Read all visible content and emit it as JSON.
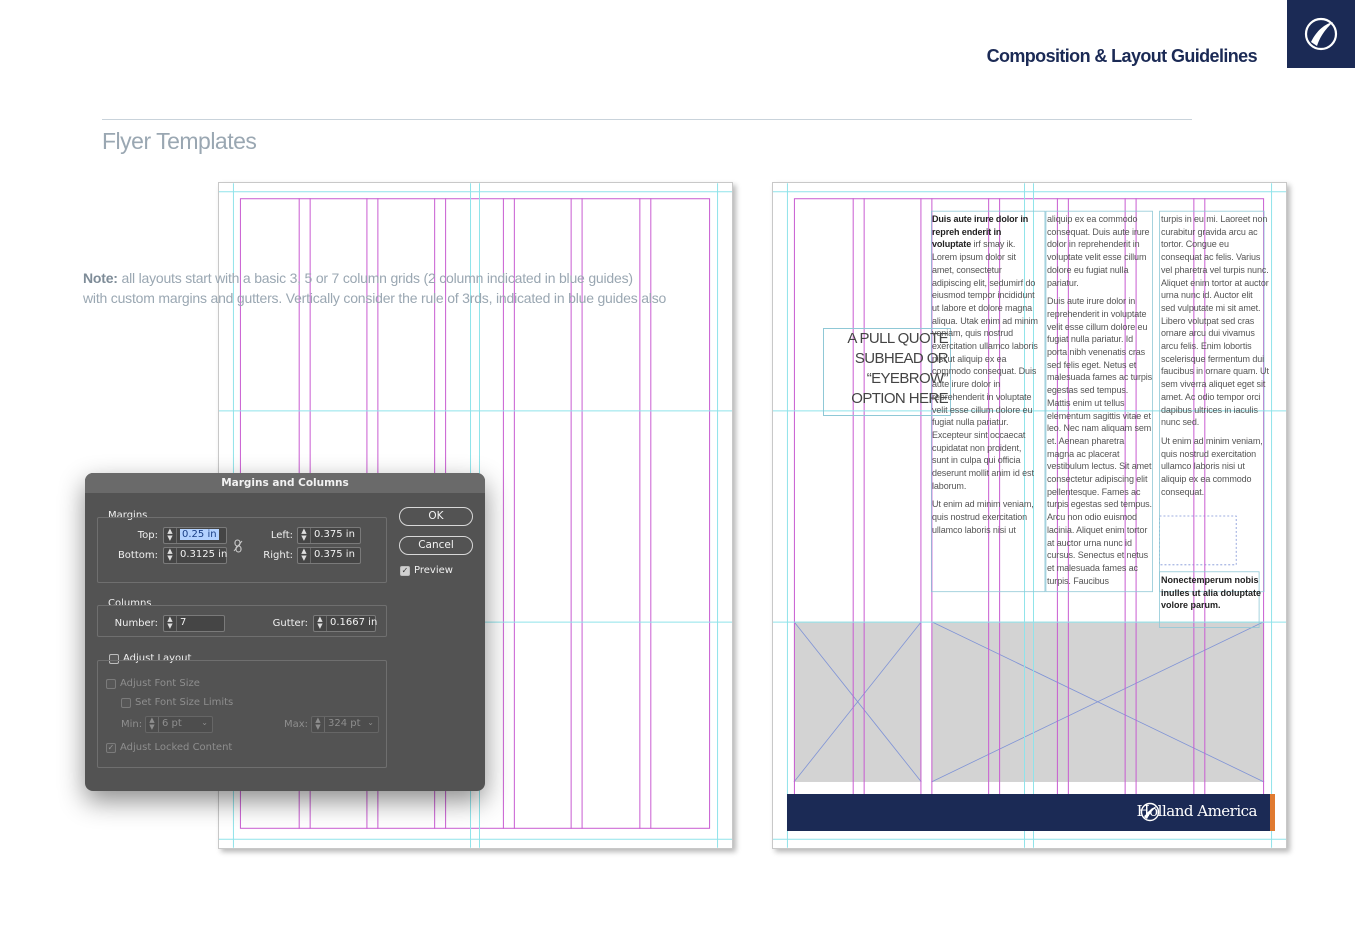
{
  "header": {
    "title": "Composition & Layout Guidelines",
    "brand_icon": "holland-america-wave-icon"
  },
  "section": {
    "title": "Flyer Templates"
  },
  "note": {
    "label": "Note:",
    "line1": "all layouts start with a basic 3, 5 or 7 column grids (2 column indicated in blue guides)",
    "line2": "with custom margins and gutters. Vertically consider the rule of 3rds, indicated in blue guides also"
  },
  "flyer": {
    "pull_quote": [
      "A PULL QUOTE",
      "SUBHEAD OR",
      "“EYEBROW”",
      "OPTION HERE"
    ],
    "col1_lead": "Duis aute irure dolor in repreh enderit in voluptate",
    "col1_p1": "irf smay ik. Lorem ipsum dolor sit amet, consectetur adipiscing elit, sedumirf do eiusmod tempor incididunt ut labore et dolore magna aliqua. Utak enim ad minim veniam, quis nostrud exercitation ullamco laboris nisi ut aliquip ex ea commodo consequat. Duis aute irure dolor in reprehenderit in voluptate velit esse cillum dolore eu fugiat nulla pariatur. Excepteur sint occaecat cupidatat non proident, sunt in culpa qui officia deserunt mollit anim id est laborum.",
    "col1_p2": "Ut enim ad minim veniam, quis nostrud exercitation ullamco laboris nisi ut",
    "col2_p1": "aliquip ex ea commodo consequat. Duis aute irure dolor in reprehenderit in voluptate velit esse cillum dolore eu fugiat nulla pariatur.",
    "col2_p2": "Duis aute irure dolor in reprehenderit in voluptate velit esse cillum dolore eu fugiat nulla pariatur. Id porta nibh venenatis cras sed felis eget. Netus et malesuada fames ac turpis egestas sed tempus. Mattis enim ut tellus elementum sagittis vitae et leo. Nec nam aliquam sem et. Aenean pharetra magna ac placerat vestibulum lectus. Sit amet consectetur adipiscing elit pellentesque. Fames ac turpis egestas sed tempus. Arcu non odio euismod lacinia. Aliquet enim tortor at auctor urna nunc id cursus. Senectus et netus et malesuada fames ac turpis. Faucibus",
    "col3_p1": "turpis in eu mi. Laoreet non curabitur gravida arcu ac tortor. Congue eu consequat ac felis. Varius vel pharetra vel turpis nunc. Aliquet enim tortor at auctor urna nunc id. Auctor elit sed vulputate mi sit amet. Libero volutpat sed cras ornare arcu dui vivamus arcu felis. Enim lobortis scelerisque fermentum dui faucibus in ornare quam. Ut sem viverra aliquet eget sit amet. Ac odio tempor orci dapibus ultrices in iaculis nunc sed.",
    "col3_p2": "Ut enim ad minim veniam, quis nostrud exercitation ullamco laboris nisi ut aliquip ex ea commodo consequat.",
    "bold_note": "Nonectemperum nobis inulles ut alia doluptate volore parum.",
    "logo": "Holland America",
    "accent_color": "#e07a30",
    "band_color": "#1b2a55"
  },
  "dialog": {
    "title": "Margins and Columns",
    "margins_label": "Margins",
    "top_label": "Top:",
    "top_value": "0.25 in",
    "bottom_label": "Bottom:",
    "bottom_value": "0.3125 in",
    "left_label": "Left:",
    "left_value": "0.375 in",
    "right_label": "Right:",
    "right_value": "0.375 in",
    "columns_label": "Columns",
    "number_label": "Number:",
    "number_value": "7",
    "gutter_label": "Gutter:",
    "gutter_value": "0.1667 in",
    "ok": "OK",
    "cancel": "Cancel",
    "preview": "Preview",
    "adjust_layout": "Adjust Layout",
    "adjust_font_size": "Adjust Font Size",
    "set_font_size_limits": "Set Font Size Limits",
    "min_label": "Min:",
    "min_value": "6 pt",
    "max_label": "Max:",
    "max_value": "324 pt",
    "adjust_locked": "Adjust Locked Content"
  }
}
